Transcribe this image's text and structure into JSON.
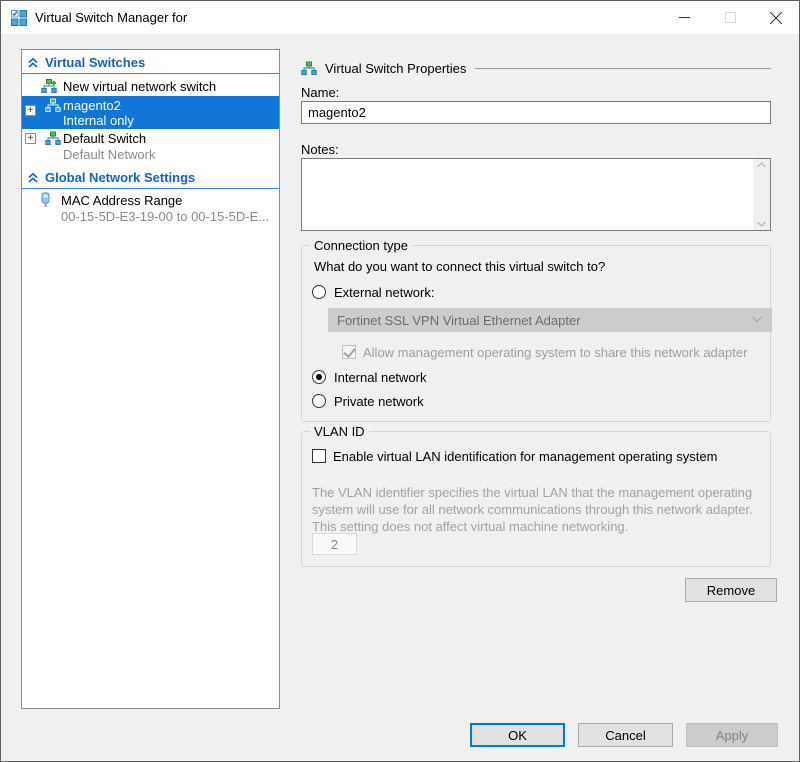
{
  "window": {
    "title": "Virtual Switch Manager for"
  },
  "icons": {
    "app": "hyperv-switch-manager-icon",
    "minimize": "minimize-icon",
    "maximize": "maximize-icon",
    "close": "close-icon",
    "section_chevron": "double-chevron-up-icon",
    "new_switch": "network-switch-add-icon",
    "switch": "network-switch-icon",
    "mac": "network-adapter-icon"
  },
  "colors": {
    "selection": "#1177d7",
    "header_blue": "#1464c0",
    "accent": "#0078d7"
  },
  "sidebar": {
    "expander_glyph": "+",
    "virtual_switches_header": "Virtual Switches",
    "new_switch_label": "New virtual network switch",
    "switches": [
      {
        "name": "magento2",
        "subtitle": "Internal only",
        "selected": true
      },
      {
        "name": "Default Switch",
        "subtitle": "Default Network",
        "selected": false
      }
    ],
    "global_settings_header": "Global Network Settings",
    "mac_item": {
      "label": "MAC Address Range",
      "value": "00-15-5D-E3-19-00 to 00-15-5D-E..."
    }
  },
  "main": {
    "section_title": "Virtual Switch Properties",
    "name_label": "Name:",
    "name_value": "magento2",
    "notes_label": "Notes:",
    "notes_value": "",
    "connection": {
      "group_label": "Connection type",
      "question": "What do you want to connect this virtual switch to?",
      "external_label": "External network:",
      "adapter_value": "Fortinet SSL VPN Virtual Ethernet Adapter",
      "share_label": "Allow management operating system to share this network adapter",
      "share_checked": true,
      "internal_label": "Internal network",
      "private_label": "Private network",
      "selected_option": "internal"
    },
    "vlan": {
      "group_label": "VLAN ID",
      "enable_label": "Enable virtual LAN identification for management operating system",
      "enable_checked": false,
      "description": "The VLAN identifier specifies the virtual LAN that the management operating system will use for all network communications through this network adapter. This setting does not affect virtual machine networking.",
      "vlan_value": "2"
    },
    "remove_label": "Remove"
  },
  "footer": {
    "ok_label": "OK",
    "cancel_label": "Cancel",
    "apply_label": "Apply"
  }
}
